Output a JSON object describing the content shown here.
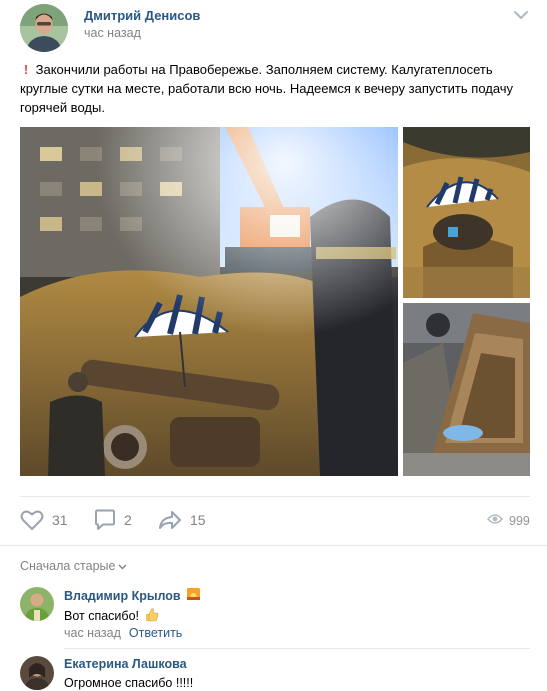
{
  "post": {
    "author": "Дмитрий Денисов",
    "time": "час назад",
    "text_excl": "!",
    "text": "Закончили работы на Правобережье. Заполняем систему. Калугатеплосеть круглые сутки на месте, работали всю ночь. Надеемся к вечеру запустить подачу горячей воды.",
    "photos": [
      {
        "name": "night-excavation-crane"
      },
      {
        "name": "worker-under-umbrella"
      },
      {
        "name": "trench-wooden-shelter"
      }
    ]
  },
  "actions": {
    "likes": "31",
    "comments": "2",
    "shares": "15",
    "views": "999"
  },
  "comments_section": {
    "sort_label": "Сначала старые"
  },
  "comments": [
    {
      "author": "Владимир Крылов",
      "text": "Вот спасибо!",
      "time": "час назад",
      "reply": "Ответить"
    },
    {
      "author": "Екатерина Лашкова",
      "text": "Огромное спасибо !!!!!"
    }
  ],
  "colors": {
    "link": "#2a5885",
    "muted": "#828282",
    "accent_red": "#e64646"
  }
}
